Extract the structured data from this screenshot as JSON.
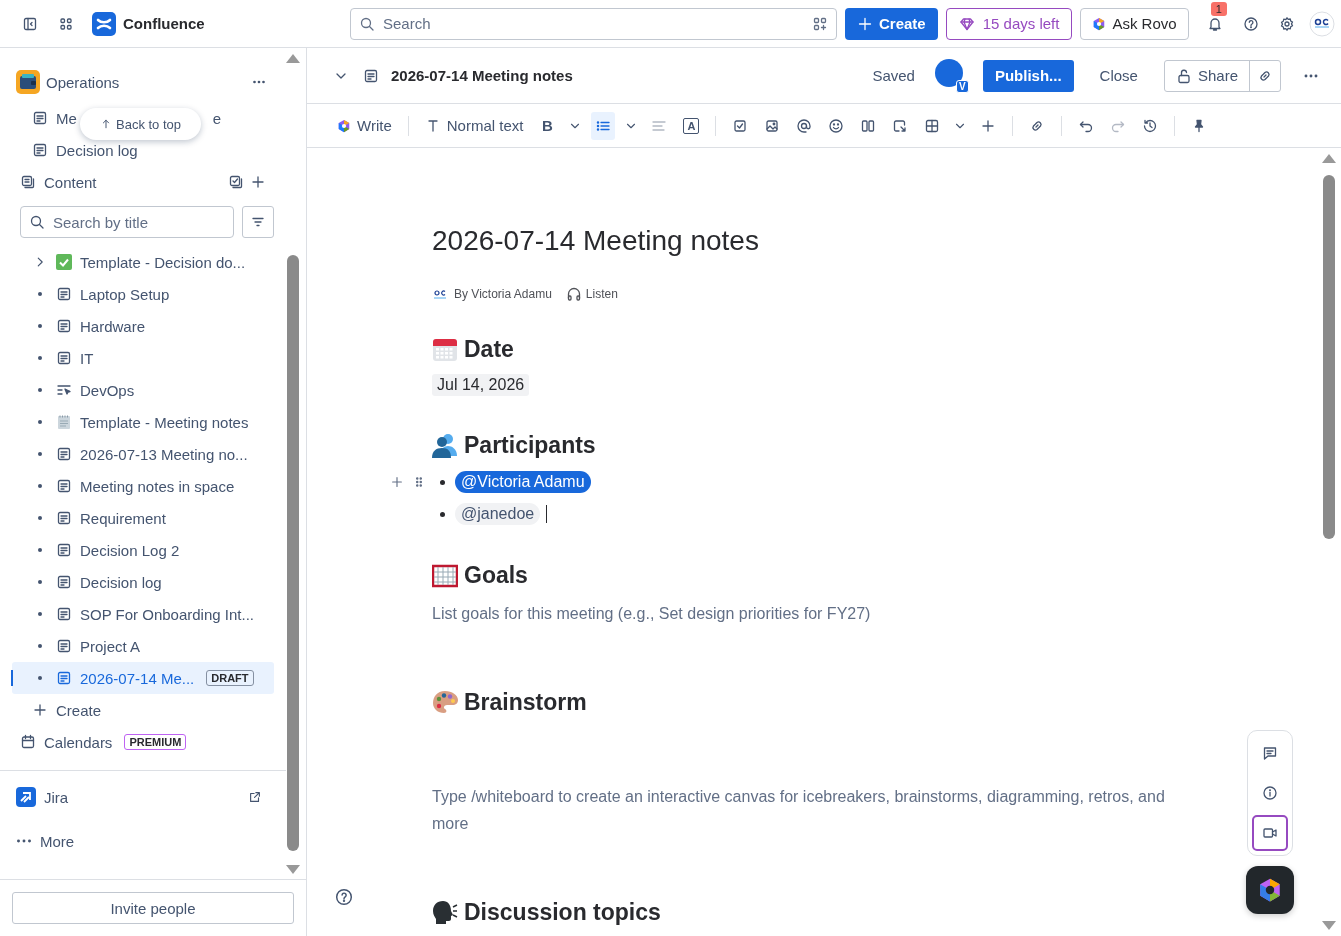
{
  "topbar": {
    "product": "Confluence",
    "search": {
      "placeholder": "Search"
    },
    "create": "Create",
    "trial": "15 days left",
    "ask": "Ask Rovo",
    "notifications": "1"
  },
  "sidebar": {
    "space": "Operations",
    "back_to_top": "Back to top",
    "pinned": [
      {
        "label_start": "Me",
        "label_end": "e"
      },
      {
        "label_start": "Decision log"
      }
    ],
    "content_header": "Content",
    "search": {
      "placeholder": "Search by title"
    },
    "tree": [
      {
        "label": "Template - Decision do...",
        "kind": "check",
        "expandable": true,
        "selected": false
      },
      {
        "label": "Laptop Setup",
        "kind": "page",
        "expandable": false,
        "selected": false
      },
      {
        "label": "Hardware",
        "kind": "page",
        "expandable": false,
        "selected": false
      },
      {
        "label": "IT",
        "kind": "page",
        "expandable": false,
        "selected": false
      },
      {
        "label": "DevOps",
        "kind": "board",
        "expandable": false,
        "selected": false
      },
      {
        "label": "Template - Meeting notes",
        "kind": "notepad",
        "expandable": false,
        "selected": false
      },
      {
        "label": "2026-07-13 Meeting no...",
        "kind": "page",
        "expandable": false,
        "selected": false
      },
      {
        "label": "Meeting notes in space",
        "kind": "page",
        "expandable": false,
        "selected": false
      },
      {
        "label": "Requirement",
        "kind": "page",
        "expandable": false,
        "selected": false
      },
      {
        "label": "Decision Log 2",
        "kind": "page",
        "expandable": false,
        "selected": false
      },
      {
        "label": "Decision log",
        "kind": "page",
        "expandable": false,
        "selected": false
      },
      {
        "label": "SOP For Onboarding Int...",
        "kind": "page",
        "expandable": false,
        "selected": false
      },
      {
        "label": "Project A",
        "kind": "page",
        "expandable": false,
        "selected": false
      },
      {
        "label": "2026-07-14 Me...",
        "kind": "page",
        "expandable": false,
        "selected": true,
        "badge": "DRAFT"
      }
    ],
    "create": "Create",
    "calendars": {
      "label": "Calendars",
      "badge": "PREMIUM"
    },
    "apps": [
      {
        "label": "Jira",
        "kind": "jira"
      },
      {
        "label": "More",
        "kind": "more"
      }
    ],
    "invite": "Invite people"
  },
  "header": {
    "title": "2026-07-14 Meeting notes",
    "status": "Saved",
    "avatar_badge": "V",
    "publish": "Publish...",
    "close": "Close",
    "share": "Share"
  },
  "toolbar": [
    [
      {
        "kind": "write",
        "label": "Write",
        "active": false,
        "disabled": false
      }
    ],
    [
      {
        "kind": "text_style",
        "label": "Normal text",
        "active": false,
        "disabled": false
      },
      {
        "kind": "bold",
        "label": "B",
        "active": false,
        "disabled": false
      },
      {
        "kind": "chevron",
        "active": false,
        "disabled": false
      },
      {
        "kind": "bullet_list",
        "active": true,
        "disabled": false
      },
      {
        "kind": "chevron",
        "active": false,
        "disabled": false
      },
      {
        "kind": "align",
        "active": false,
        "disabled": true
      },
      {
        "kind": "text_color",
        "label": "A",
        "active": false,
        "disabled": false
      }
    ],
    [
      {
        "kind": "task",
        "active": false,
        "disabled": false
      },
      {
        "kind": "image",
        "active": false,
        "disabled": false
      },
      {
        "kind": "mention",
        "active": false,
        "disabled": false
      },
      {
        "kind": "emoji",
        "active": false,
        "disabled": false
      },
      {
        "kind": "layout",
        "active": false,
        "disabled": false
      },
      {
        "kind": "smart_link",
        "active": false,
        "disabled": false
      },
      {
        "kind": "table",
        "active": false,
        "disabled": false
      },
      {
        "kind": "chevron",
        "active": false,
        "disabled": false
      },
      {
        "kind": "plus",
        "active": false,
        "disabled": false
      }
    ],
    [
      {
        "kind": "link",
        "active": false,
        "disabled": false
      }
    ],
    [
      {
        "kind": "undo",
        "active": false,
        "disabled": false
      },
      {
        "kind": "redo",
        "active": false,
        "disabled": true
      },
      {
        "kind": "history",
        "active": false,
        "disabled": false
      }
    ],
    [
      {
        "kind": "pin",
        "active": false,
        "disabled": false
      }
    ]
  ],
  "page": {
    "title": "2026-07-14 Meeting notes",
    "byline": "By Victoria Adamu",
    "listen": "Listen",
    "sections": [
      {
        "kind": "calendar",
        "heading": "Date",
        "body": {
          "kind": "date",
          "text": "Jul 14, 2026"
        }
      },
      {
        "kind": "people",
        "heading": "Participants",
        "body": {
          "kind": "mentions",
          "items": [
            {
              "text": "@Victoria Adamu",
              "selected": true,
              "caret": false
            },
            {
              "text": "@janedoe",
              "selected": false,
              "caret": true
            }
          ]
        }
      },
      {
        "kind": "goal",
        "heading": "Goals",
        "body": {
          "kind": "placeholder",
          "text": "List goals for this meeting (e.g., Set design priorities for FY27)"
        }
      },
      {
        "kind": "palette",
        "heading": "Brainstorm",
        "body": {
          "kind": "whiteboard",
          "text": "Type /whiteboard to create an interactive canvas for icebreakers, brainstorms, diagramming, retros, and more"
        }
      },
      {
        "kind": "speaker",
        "heading": "Discussion topics"
      }
    ]
  },
  "side_tools": [
    {
      "kind": "comment",
      "selected": false
    },
    {
      "kind": "info",
      "selected": false
    },
    {
      "kind": "video",
      "selected": true
    }
  ]
}
